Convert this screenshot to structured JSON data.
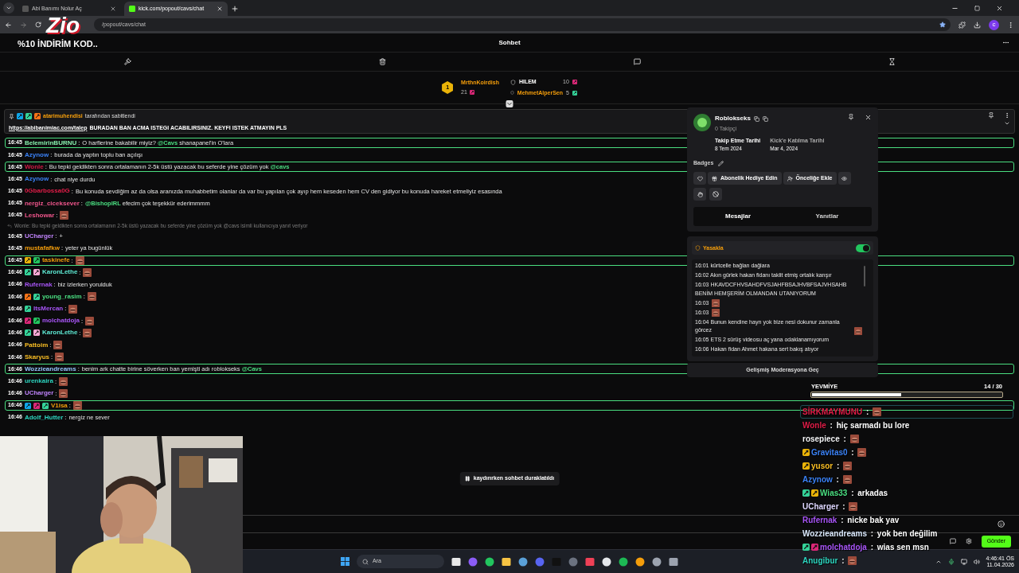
{
  "browser": {
    "tabs": [
      {
        "title": "Abi Banımı Nolur Aç",
        "selected": false
      },
      {
        "title": "kick.com/popout/cavs/chat",
        "selected": true
      }
    ],
    "address": "/popout/cavs/chat",
    "profile_initial": "c"
  },
  "stream_logo": {
    "brand": "Zio",
    "promo": "%10 İNDİRİM KOD.."
  },
  "chat": {
    "title": "Sohbet",
    "leaderboard": {
      "rank": "1",
      "leader": "MrthnKoirdish",
      "leader_count": "21",
      "others": [
        {
          "name": "HILEM",
          "count": "10",
          "color": "#ffffff"
        },
        {
          "name": "MehmetAlperSen",
          "count": "5",
          "color": "#f59e0b"
        }
      ]
    },
    "pinned": {
      "badges": [
        {
          "kind": "mod"
        },
        {
          "kind": "founder"
        },
        {
          "kind": "og"
        }
      ],
      "by": "atarimuhendisi",
      "note": "tarafından sabitlendi",
      "link": "https://abibanimiac.com/talep",
      "text": "BURADAN BAN ACMA ISTEGI ACABILIRSINIZ. KEYFI ISTEK ATMAYIN PLS"
    },
    "separator": ":",
    "messages": [
      {
        "kind": "message",
        "time": "16:45",
        "user": "BelemirinBURNU",
        "color": "#86efac",
        "highlighted": true,
        "parts": [
          {
            "text": "O harflerine bakabilir miyiz? ",
            "mention": false
          },
          {
            "text": "@Cavs",
            "mention": true
          },
          {
            "text": " shanapanel'in O'lara",
            "mention": false
          }
        ]
      },
      {
        "kind": "message",
        "time": "16:45",
        "user": "Azynow",
        "color": "#3b82f6",
        "highlighted": false,
        "parts": [
          {
            "text": "burada da yaptın toplu ban açılışı",
            "mention": false
          }
        ]
      },
      {
        "kind": "message",
        "time": "16:45",
        "user": "Wonle",
        "color": "#d11a44",
        "highlighted": true,
        "parts": [
          {
            "text": "Bu tepki geldikten sonra ortalamanın 2-5k üstü yazacak bu seferde yine çözüm yok ",
            "mention": false
          },
          {
            "text": "@cavs",
            "mention": true
          }
        ]
      },
      {
        "kind": "message",
        "time": "16:45",
        "user": "Azynow",
        "color": "#3b82f6",
        "highlighted": false,
        "parts": [
          {
            "text": "chat niye durdu",
            "mention": false
          }
        ]
      },
      {
        "kind": "message",
        "time": "16:45",
        "user": "0Gbarbossa0G",
        "color": "#e11d48",
        "highlighted": false,
        "parts": [
          {
            "text": "Bu konuda sevdiğim az da olsa aranızda muhabbetim olanlar da var bu yapılan çok ayıp hem keseden hem CV den gidiyor bu konuda hareket etmeliyiz esasında",
            "mention": false
          }
        ]
      },
      {
        "kind": "message",
        "time": "16:45",
        "user": "nergiz_ciceksever",
        "color": "#f0568c",
        "highlighted": false,
        "parts": [
          {
            "text": "@BishopIRL",
            "mention": true
          },
          {
            "text": " efecim çok teşekkür ederimmmm",
            "mention": false
          }
        ]
      },
      {
        "kind": "message",
        "time": "16:45",
        "user": "Leshowar",
        "color": "#f0568c",
        "highlighted": false,
        "emote": true
      },
      {
        "kind": "reply",
        "text": "Wonle: Bu tepki geldikten sonra ortalamanın 2-5k üstü yazacak bu seferde yine çözüm yok @cavs isimli kullanıcıya yanıt veriyor"
      },
      {
        "kind": "message",
        "time": "16:45",
        "user": "UCharger",
        "color": "#c084fc",
        "highlighted": false,
        "parts": [
          {
            "text": "+",
            "mention": false
          }
        ]
      },
      {
        "kind": "message",
        "time": "16:45",
        "user": "mustafafkw",
        "color": "#f59e0b",
        "highlighted": false,
        "parts": [
          {
            "text": "yeter ya bugünlük",
            "mention": false
          }
        ]
      },
      {
        "kind": "message",
        "time": "16:45",
        "user": "taskinefe",
        "color": "#f59e0b",
        "highlighted": true,
        "badges": [
          {
            "kind": "crown"
          },
          {
            "kind": "verified"
          }
        ],
        "emote": true
      },
      {
        "kind": "message",
        "time": "16:46",
        "user": "KaronLethe",
        "color": "#5eead4",
        "highlighted": false,
        "badges": [
          {
            "kind": "sub"
          },
          {
            "kind": "gift"
          }
        ],
        "emote": true
      },
      {
        "kind": "message",
        "time": "16:46",
        "user": "Rufernak",
        "color": "#a855f7",
        "highlighted": false,
        "parts": [
          {
            "text": "biz izlerken yorulduk",
            "mention": false
          }
        ]
      },
      {
        "kind": "message",
        "time": "16:46",
        "user": "young_rasim",
        "color": "#4ade80",
        "highlighted": false,
        "badges": [
          {
            "kind": "og"
          },
          {
            "kind": "founder"
          }
        ],
        "emote": true
      },
      {
        "kind": "message",
        "time": "16:46",
        "user": "ItsMercan",
        "color": "#a855f7",
        "highlighted": false,
        "badges": [
          {
            "kind": "sub"
          }
        ],
        "emote": true
      },
      {
        "kind": "message",
        "time": "16:46",
        "user": "molchatdoja",
        "color": "#a855f7",
        "highlighted": false,
        "badges": [
          {
            "kind": "vip"
          },
          {
            "kind": "verified"
          }
        ],
        "emote": true
      },
      {
        "kind": "message",
        "time": "16:46",
        "user": "KaronLethe",
        "color": "#5eead4",
        "highlighted": false,
        "badges": [
          {
            "kind": "sub"
          },
          {
            "kind": "gift"
          }
        ],
        "emote": true
      },
      {
        "kind": "message",
        "time": "16:46",
        "user": "Pattoim",
        "color": "#fbbf24",
        "highlighted": false,
        "emote": true
      },
      {
        "kind": "message",
        "time": "16:46",
        "user": "Skaryus",
        "color": "#fbbf24",
        "highlighted": false,
        "emote": true
      },
      {
        "kind": "message",
        "time": "16:46",
        "user": "Wozzieandreams",
        "color": "#93c5fd",
        "highlighted": true,
        "parts": [
          {
            "text": "benim ark chatte birine söverken ban yemişti adı roblokseks ",
            "mention": false
          },
          {
            "text": "@Cavs",
            "mention": true
          }
        ]
      },
      {
        "kind": "message",
        "time": "16:46",
        "user": "urenkaira",
        "color": "#2dd4bf",
        "highlighted": false,
        "emote": true
      },
      {
        "kind": "message",
        "time": "16:46",
        "user": "UCharger",
        "color": "#c084fc",
        "highlighted": false,
        "emote": true
      },
      {
        "kind": "message",
        "time": "16:46",
        "user": "V1isa",
        "color": "#f59e0b",
        "highlighted": true,
        "badges": [
          {
            "kind": "mod"
          },
          {
            "kind": "vip"
          },
          {
            "kind": "founder"
          }
        ],
        "emote": true
      },
      {
        "kind": "message",
        "time": "16:46",
        "user": "Adolf_Hutter",
        "color": "#2dd4bf",
        "highlighted": false,
        "parts": [
          {
            "text": "nergiz ne sever",
            "mention": false
          }
        ]
      }
    ],
    "paused_notice": "kaydırırken sohbet duraklatıldı",
    "send_button": "Gönder"
  },
  "user_card": {
    "name": "Roblokseks",
    "followers": "0 Takipçi",
    "stats": [
      {
        "label": "Takip Etme Tarihi",
        "value": "8 Tem 2024"
      },
      {
        "label": "Kick'e Katılma Tarihi",
        "value": "Mar 4, 2024"
      }
    ],
    "badges_label": "Badges",
    "actions": [
      "Abonelik Hediye Edin",
      "Önceliğe Ekle"
    ],
    "tabs": [
      {
        "label": "Mesajlar",
        "selected": true
      },
      {
        "label": "Yanıtlar",
        "selected": false
      }
    ],
    "ban": {
      "label": "Yasakla",
      "on": true
    },
    "log": [
      {
        "time": "16:01",
        "text": "kürtcelle bağlan dağlara"
      },
      {
        "time": "16:02",
        "text": "Akın gürlek hakan fidanı taklit etmiş ortalık karışır"
      },
      {
        "time": "16:03",
        "text": "HKAVDCFHVSAHDFVSJAHFBSAJHVBFSAJVHSAHB BENİM HEMŞERİM OLMANDAN UTANIYORUM"
      },
      {
        "time": "16:03",
        "emote": true
      },
      {
        "time": "16:03",
        "emote": true
      },
      {
        "time": "16:04",
        "text": "Bunun kendine hayrı yok bize nesi dokunur zamanla görcez",
        "emote": true
      },
      {
        "time": "16:05",
        "text": "ETS 2 sürüş videosu aç yana odaklanamıyorum"
      },
      {
        "time": "16:06",
        "text": "Hakan fidan Ahmet hakana sert bakış atıyor"
      }
    ],
    "footer": "Gelişmiş Moderasyona Geç"
  },
  "overlay_chat": {
    "goal": {
      "title": "YEVMİYE",
      "count": "14 / 30",
      "level": 0.47
    },
    "separator": " : ",
    "messages": [
      {
        "user": "SİRKMAYMUNU",
        "color": "#e11d48",
        "highlighted": true,
        "emote": true
      },
      {
        "user": "Wonle",
        "color": "#e11d48",
        "highlighted": false,
        "text": "hiç sarmadı bu lore"
      },
      {
        "user": "rosepiece",
        "color": "#f3f4f6",
        "highlighted": false,
        "emote": true
      },
      {
        "user": "Gravitas0",
        "color": "#3b82f6",
        "highlighted": false,
        "badges": [
          {
            "kind": "crown"
          }
        ],
        "emote": true
      },
      {
        "user": "yusor",
        "color": "#fbbf24",
        "highlighted": false,
        "badges": [
          {
            "kind": "crown"
          }
        ],
        "emote": true
      },
      {
        "user": "Azynow",
        "color": "#3b82f6",
        "highlighted": false,
        "emote": true
      },
      {
        "user": "Wias33",
        "color": "#4ade80",
        "highlighted": false,
        "badges": [
          {
            "kind": "founder"
          },
          {
            "kind": "crown"
          }
        ],
        "text": "arkadas"
      },
      {
        "user": "UCharger",
        "color": "#ddd6fe",
        "highlighted": false,
        "emote": true
      },
      {
        "user": "Rufernak",
        "color": "#a855f7",
        "highlighted": false,
        "text": "nicke bak yav"
      },
      {
        "user": "Wozzieandreams",
        "color": "#dbeafe",
        "highlighted": false,
        "text": "yok ben değilim"
      },
      {
        "user": "molchatdoja",
        "color": "#a855f7",
        "highlighted": false,
        "badges": [
          {
            "kind": "founder"
          },
          {
            "kind": "vip"
          }
        ],
        "text": "wias sen msn"
      },
      {
        "user": "Anugibur",
        "color": "#2dd4bf",
        "highlighted": false,
        "emote": true
      }
    ]
  },
  "taskbar": {
    "search_placeholder": "Ara",
    "time": "4:46:41 ÖS",
    "date": "11.04.2026"
  }
}
